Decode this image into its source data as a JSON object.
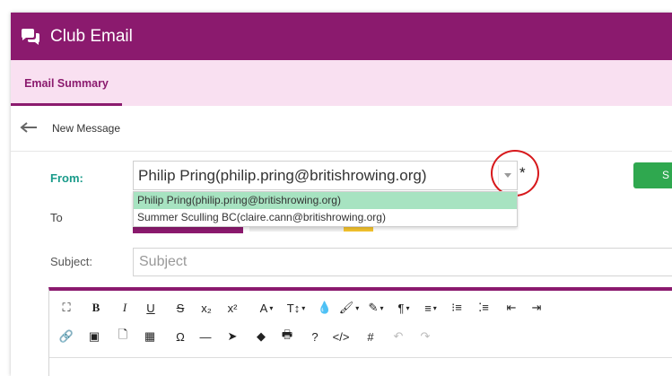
{
  "header": {
    "title": "Club Email"
  },
  "tabs": [
    {
      "label": "Email Summary"
    }
  ],
  "subheader": {
    "title": "New Message"
  },
  "form": {
    "from_label": "From:",
    "from_value": "Philip Pring(philip.pring@britishrowing.org)",
    "required_marker": "*",
    "from_options": [
      "Philip Pring(philip.pring@britishrowing.org)",
      "Summer Sculling BC(claire.cann@britishrowing.org)"
    ],
    "to_label": "To",
    "subject_label": "Subject:",
    "subject_placeholder": "Subject",
    "send_label": "S"
  },
  "toolbar": {
    "row1": [
      {
        "name": "fullscreen-icon",
        "text": "⛶"
      },
      {
        "name": "bold-button",
        "text": "B"
      },
      {
        "name": "italic-button",
        "text": "I"
      },
      {
        "name": "underline-button",
        "text": "U"
      },
      {
        "name": "strikethrough-button",
        "text": "S"
      },
      {
        "name": "subscript-button",
        "text": "x₂"
      },
      {
        "name": "superscript-button",
        "text": "x²"
      },
      {
        "name": "font-family-button",
        "text": "A"
      },
      {
        "name": "font-size-button",
        "text": "T↕"
      },
      {
        "name": "text-color-icon",
        "text": "💧"
      },
      {
        "name": "background-color-icon",
        "text": "🖌"
      },
      {
        "name": "inline-style-icon",
        "text": "✎"
      },
      {
        "name": "paragraph-format-button",
        "text": "¶"
      },
      {
        "name": "align-button",
        "text": "≡"
      },
      {
        "name": "ordered-list-icon",
        "text": "⁝≡"
      },
      {
        "name": "unordered-list-icon",
        "text": "⁚≡"
      },
      {
        "name": "outdent-icon",
        "text": "⇤"
      },
      {
        "name": "indent-icon",
        "text": "⇥"
      }
    ],
    "row2": [
      {
        "name": "link-icon",
        "text": "🔗"
      },
      {
        "name": "image-icon",
        "text": "▣"
      },
      {
        "name": "file-icon",
        "text": "🗋"
      },
      {
        "name": "table-icon",
        "text": "▦"
      },
      {
        "name": "special-characters-icon",
        "text": "Ω"
      },
      {
        "name": "horizontal-line-icon",
        "text": "—"
      },
      {
        "name": "select-all-icon",
        "text": "➤"
      },
      {
        "name": "clear-formatting-icon",
        "text": "◆"
      },
      {
        "name": "print-icon",
        "text": "🖶"
      },
      {
        "name": "help-icon",
        "text": "?"
      },
      {
        "name": "code-view-icon",
        "text": "</>"
      },
      {
        "name": "hashtag-icon",
        "text": "#"
      },
      {
        "name": "undo-icon",
        "text": "↶"
      },
      {
        "name": "redo-icon",
        "text": "↷"
      }
    ]
  },
  "colors": {
    "brand": "#8b1a6e",
    "tab_bg": "#f9e0f1",
    "from_label": "#1a9b8a",
    "option_highlight": "#a7e3c1",
    "send_button": "#2fa84f",
    "annotation_circle": "#d7191c"
  }
}
